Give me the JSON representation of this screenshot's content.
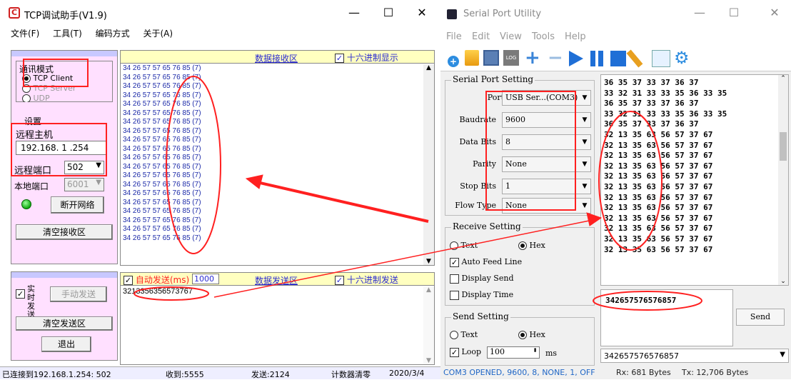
{
  "tcp": {
    "title": "TCP调试助手(V1.9)",
    "menu": [
      "文件(F)",
      "工具(T)",
      "编码方式",
      "关于(A)"
    ],
    "mode_label": "通讯模式",
    "mode_tcp_client": "TCP Client",
    "mode_tcp_server": "TCP Server",
    "mode_udp": "UDP",
    "settings_label": "设置",
    "remote_host_label": "远程主机",
    "remote_host_value": "192.168. 1 .254",
    "remote_port_label": "远程端口",
    "remote_port_value": "502",
    "local_port_label": "本地端口",
    "local_port_value": "6001",
    "disconnect_button": "断开网络",
    "clear_recv_button": "清空接收区",
    "recv_header": "数据接收区",
    "hex_display_label": "十六进制显示",
    "recv_lines": [
      "34 26 57 57 65 76 85  (7)",
      "34 26 57 57 65 76 85  (7)",
      "34 26 57 57 65 76 85  (7)",
      "34 26 57 57 65 76 85  (7)",
      "34 26 57 57 65 76 85  (7)",
      "34 26 57 57 65 76 85  (7)",
      "34 26 57 57 65 76 85  (7)",
      "34 26 57 57 65 76 85  (7)",
      "34 26 57 57 65 76 85  (7)",
      "34 26 57 57 65 76 85  (7)",
      "34 26 57 57 65 76 85  (7)",
      "34 26 57 57 65 76 85  (7)",
      "34 26 57 57 65 76 85  (7)",
      "34 26 57 57 65 76 85  (7)",
      "34 26 57 57 65 76 85  (7)",
      "34 26 57 57 65 76 85  (7)",
      "34 26 57 57 65 76 85  (7)",
      "34 26 57 57 65 76 85  (7)",
      "34 26 57 57 65 76 85  (7)",
      "34 26 57 57 65 76 85  (7)"
    ],
    "realtime_send_label": "实时发送",
    "manual_send_button": "手动发送",
    "auto_send_label": "自动发送(ms)",
    "auto_send_interval": "1000",
    "send_header": "数据发送区",
    "hex_send_label": "十六进制发送",
    "send_text": "3213356356573767",
    "clear_send_button": "清空发送区",
    "exit_button": "退出",
    "status_connected": "已连接到192.168.1.254:  502",
    "status_received": "收到:5555",
    "status_sent": "发送:2124",
    "status_clear": "计数器清零",
    "status_date": "2020/3/4"
  },
  "serial": {
    "title": "Serial Port Utility",
    "menu": [
      "File",
      "Edit",
      "View",
      "Tools",
      "Help"
    ],
    "port_setting_label": "Serial Port Setting",
    "port_label": "Port",
    "port_value": "USB Ser...(COM3)",
    "baud_label": "Baudrate",
    "baud_value": "9600",
    "databits_label": "Data Bits",
    "databits_value": "8",
    "parity_label": "Parity",
    "parity_value": "None",
    "stopbits_label": "Stop Bits",
    "stopbits_value": "1",
    "flow_label": "Flow Type",
    "flow_value": "None",
    "receive_setting_label": "Receive Setting",
    "text_option": "Text",
    "hex_option": "Hex",
    "auto_feed_label": "Auto Feed Line",
    "display_send_label": "Display Send",
    "display_time_label": "Display Time",
    "send_setting_label": "Send Setting",
    "send_text_option": "Text",
    "send_hex_option": "Hex",
    "loop_label": "Loop",
    "loop_value": "100",
    "loop_unit": "ms",
    "recv_lines": [
      "36 35 37 33 37 36 37",
      "33 32 31 33 33 35 36 33 35",
      "36 35 37 33 37 36 37",
      "33 32 31 33 33 35 36 33 35",
      "36 35 37 33 37 36 37",
      "32 13 35 63 56 57 37 67",
      "32 13 35 63 56 57 37 67",
      "32 13 35 63 56 57 37 67",
      "32 13 35 63 56 57 37 67",
      "32 13 35 63 56 57 37 67",
      "32 13 35 63 56 57 37 67",
      "32 13 35 63 56 57 37 67",
      "32 13 35 63 56 57 37 67",
      "32 13 35 63 56 57 37 67",
      "32 13 35 63 56 57 37 67",
      "32 13 35 63 56 57 37 67",
      "32 13 35 63 56 57 37 67"
    ],
    "send_input_value": "342657576576857",
    "send_button": "Send",
    "history_value": "342657576576857",
    "status_open": "COM3 OPENED, 9600, 8, NONE, 1, OFF",
    "status_rx": "Rx: 681 Bytes",
    "status_tx": "Tx: 12,706 Bytes"
  },
  "colors": {
    "annotation_red": "#ff2020",
    "tcp_panel": "#ffe0ff",
    "link_blue": "#2b2bd0"
  }
}
